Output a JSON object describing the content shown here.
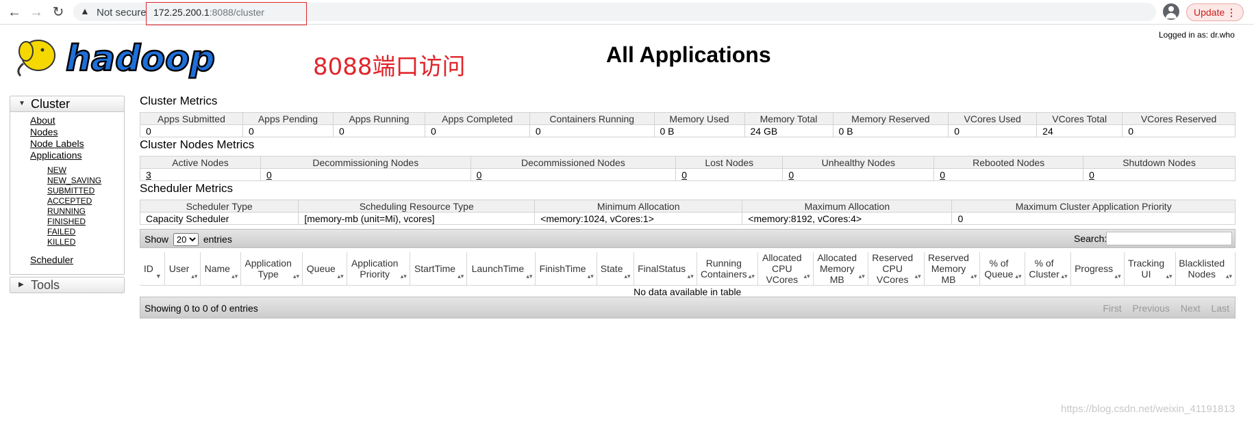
{
  "browser": {
    "not_secure": "Not secure",
    "url_host": "172.25.200.1",
    "url_rest": ":8088/cluster",
    "update_label": "Update",
    "update_dots": "⋮"
  },
  "header": {
    "logo_text": "hadoop",
    "annotation": "8088端口访问",
    "title": "All Applications",
    "logged_in": "Logged in as: dr.who"
  },
  "sidebar": {
    "cluster_label": "Cluster",
    "links": [
      "About",
      "Nodes",
      "Node Labels",
      "Applications"
    ],
    "app_states": [
      "NEW",
      "NEW_SAVING",
      "SUBMITTED",
      "ACCEPTED",
      "RUNNING",
      "FINISHED",
      "FAILED",
      "KILLED"
    ],
    "scheduler": "Scheduler",
    "tools_label": "Tools"
  },
  "cluster_metrics": {
    "title": "Cluster Metrics",
    "headers": [
      "Apps Submitted",
      "Apps Pending",
      "Apps Running",
      "Apps Completed",
      "Containers Running",
      "Memory Used",
      "Memory Total",
      "Memory Reserved",
      "VCores Used",
      "VCores Total",
      "VCores Reserved"
    ],
    "values": [
      "0",
      "0",
      "0",
      "0",
      "0",
      "0 B",
      "24 GB",
      "0 B",
      "0",
      "24",
      "0"
    ]
  },
  "node_metrics": {
    "title": "Cluster Nodes Metrics",
    "headers": [
      "Active Nodes",
      "Decommissioning Nodes",
      "Decommissioned Nodes",
      "Lost Nodes",
      "Unhealthy Nodes",
      "Rebooted Nodes",
      "Shutdown Nodes"
    ],
    "values": [
      "3",
      "0",
      "0",
      "0",
      "0",
      "0",
      "0"
    ]
  },
  "scheduler_metrics": {
    "title": "Scheduler Metrics",
    "headers": [
      "Scheduler Type",
      "Scheduling Resource Type",
      "Minimum Allocation",
      "Maximum Allocation",
      "Maximum Cluster Application Priority"
    ],
    "values": [
      "Capacity Scheduler",
      "[memory-mb (unit=Mi), vcores]",
      "<memory:1024, vCores:1>",
      "<memory:8192, vCores:4>",
      "0"
    ]
  },
  "apps_table": {
    "show_label": "Show",
    "page_size": "20",
    "entries_label": "entries",
    "search_label": "Search:",
    "columns": [
      "ID",
      "User",
      "Name",
      "Application Type",
      "Queue",
      "Application Priority",
      "StartTime",
      "LaunchTime",
      "FinishTime",
      "State",
      "FinalStatus",
      "Running Containers",
      "Allocated CPU VCores",
      "Allocated Memory MB",
      "Reserved CPU VCores",
      "Reserved Memory MB",
      "% of Queue",
      "% of Cluster",
      "Progress",
      "Tracking UI",
      "Blacklisted Nodes"
    ],
    "empty_message": "No data available in table",
    "info": "Showing 0 to 0 of 0 entries",
    "pager": [
      "First",
      "Previous",
      "Next",
      "Last"
    ]
  },
  "watermark": "https://blog.csdn.net/weixin_41191813"
}
